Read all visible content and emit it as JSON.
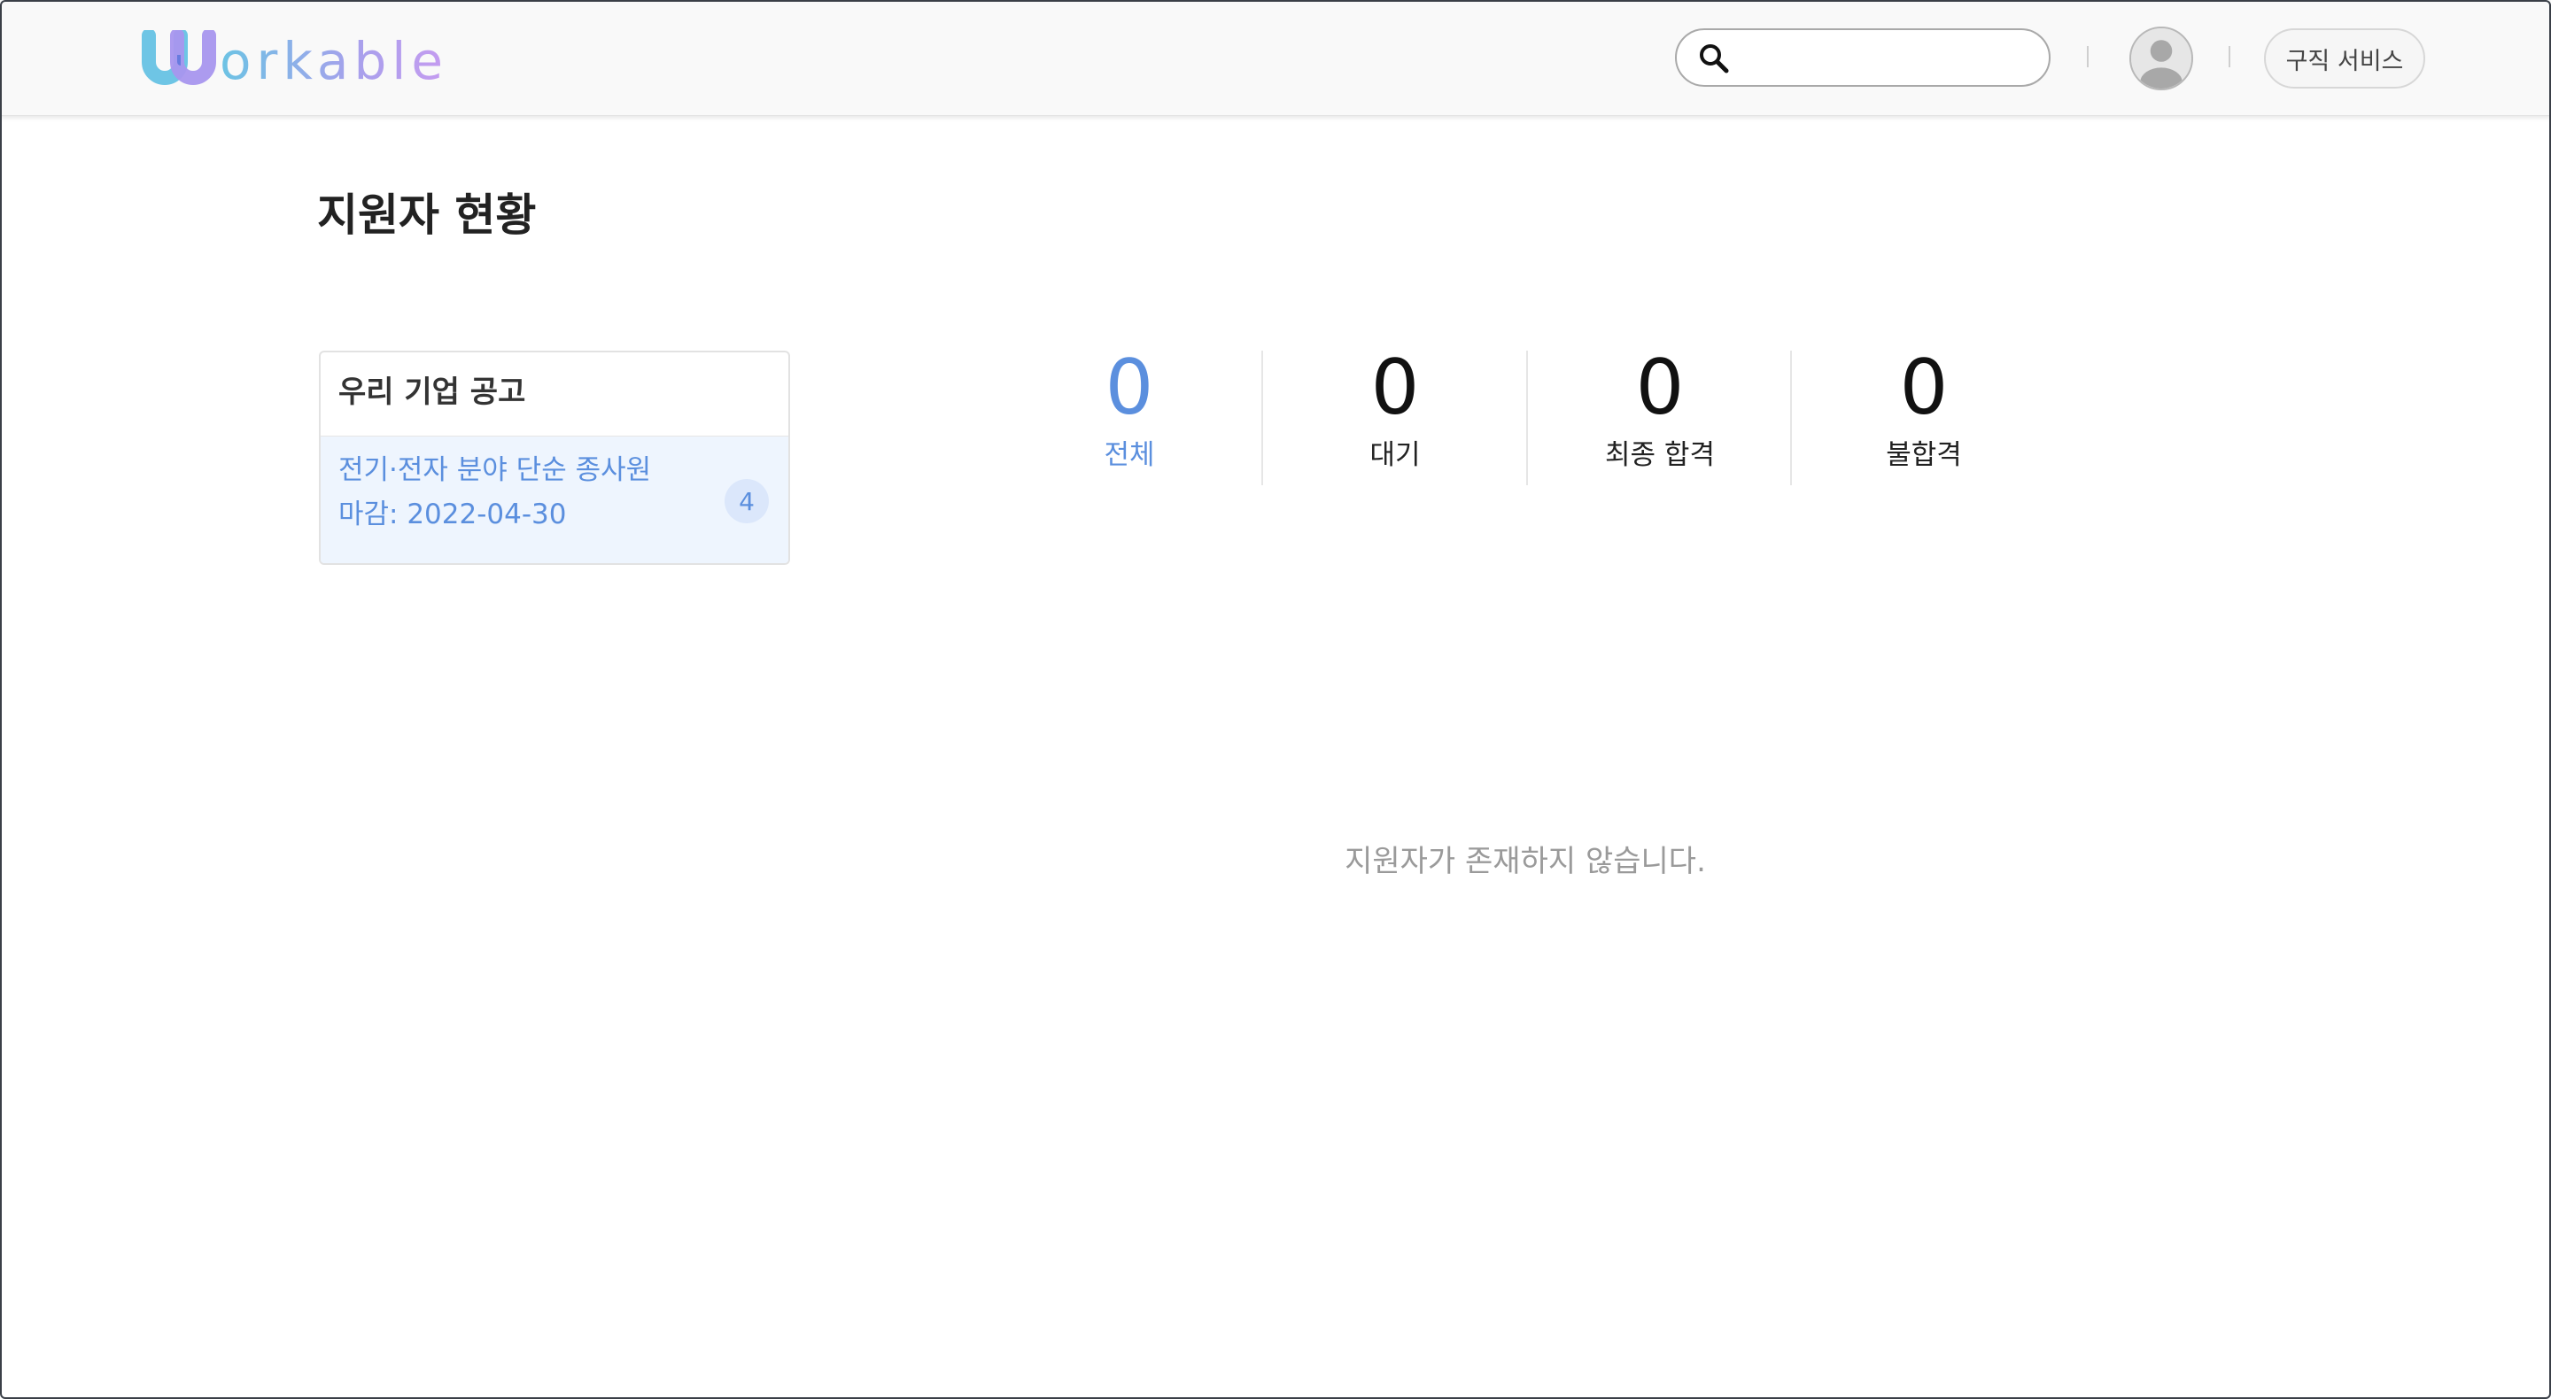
{
  "header": {
    "logo_text": "orkable",
    "search": {
      "value": "",
      "placeholder": ""
    },
    "service_button_label": "구직 서비스"
  },
  "main": {
    "page_title": "지원자 현황",
    "postings": {
      "title": "우리 기업 공고",
      "items": [
        {
          "name": "전기·전자 분야 단순 종사원",
          "deadline": "마감: 2022-04-30",
          "count": "4"
        }
      ]
    },
    "stats": [
      {
        "value": "0",
        "label": "전체",
        "active": true
      },
      {
        "value": "0",
        "label": "대기",
        "active": false
      },
      {
        "value": "0",
        "label": "최종 합격",
        "active": false
      },
      {
        "value": "0",
        "label": "불합격",
        "active": false
      }
    ],
    "empty_message": "지원자가 존재하지 않습니다."
  },
  "colors": {
    "accent": "#5b8fde",
    "logo_gradient_start": "#6cc3e4",
    "logo_gradient_end": "#c69cf0",
    "selected_item_bg": "#eef5fe",
    "muted_text": "#9a9a9a"
  },
  "icons": {
    "logo": "workable-w-logo-icon",
    "search": "search-icon",
    "avatar": "user-avatar-icon"
  }
}
